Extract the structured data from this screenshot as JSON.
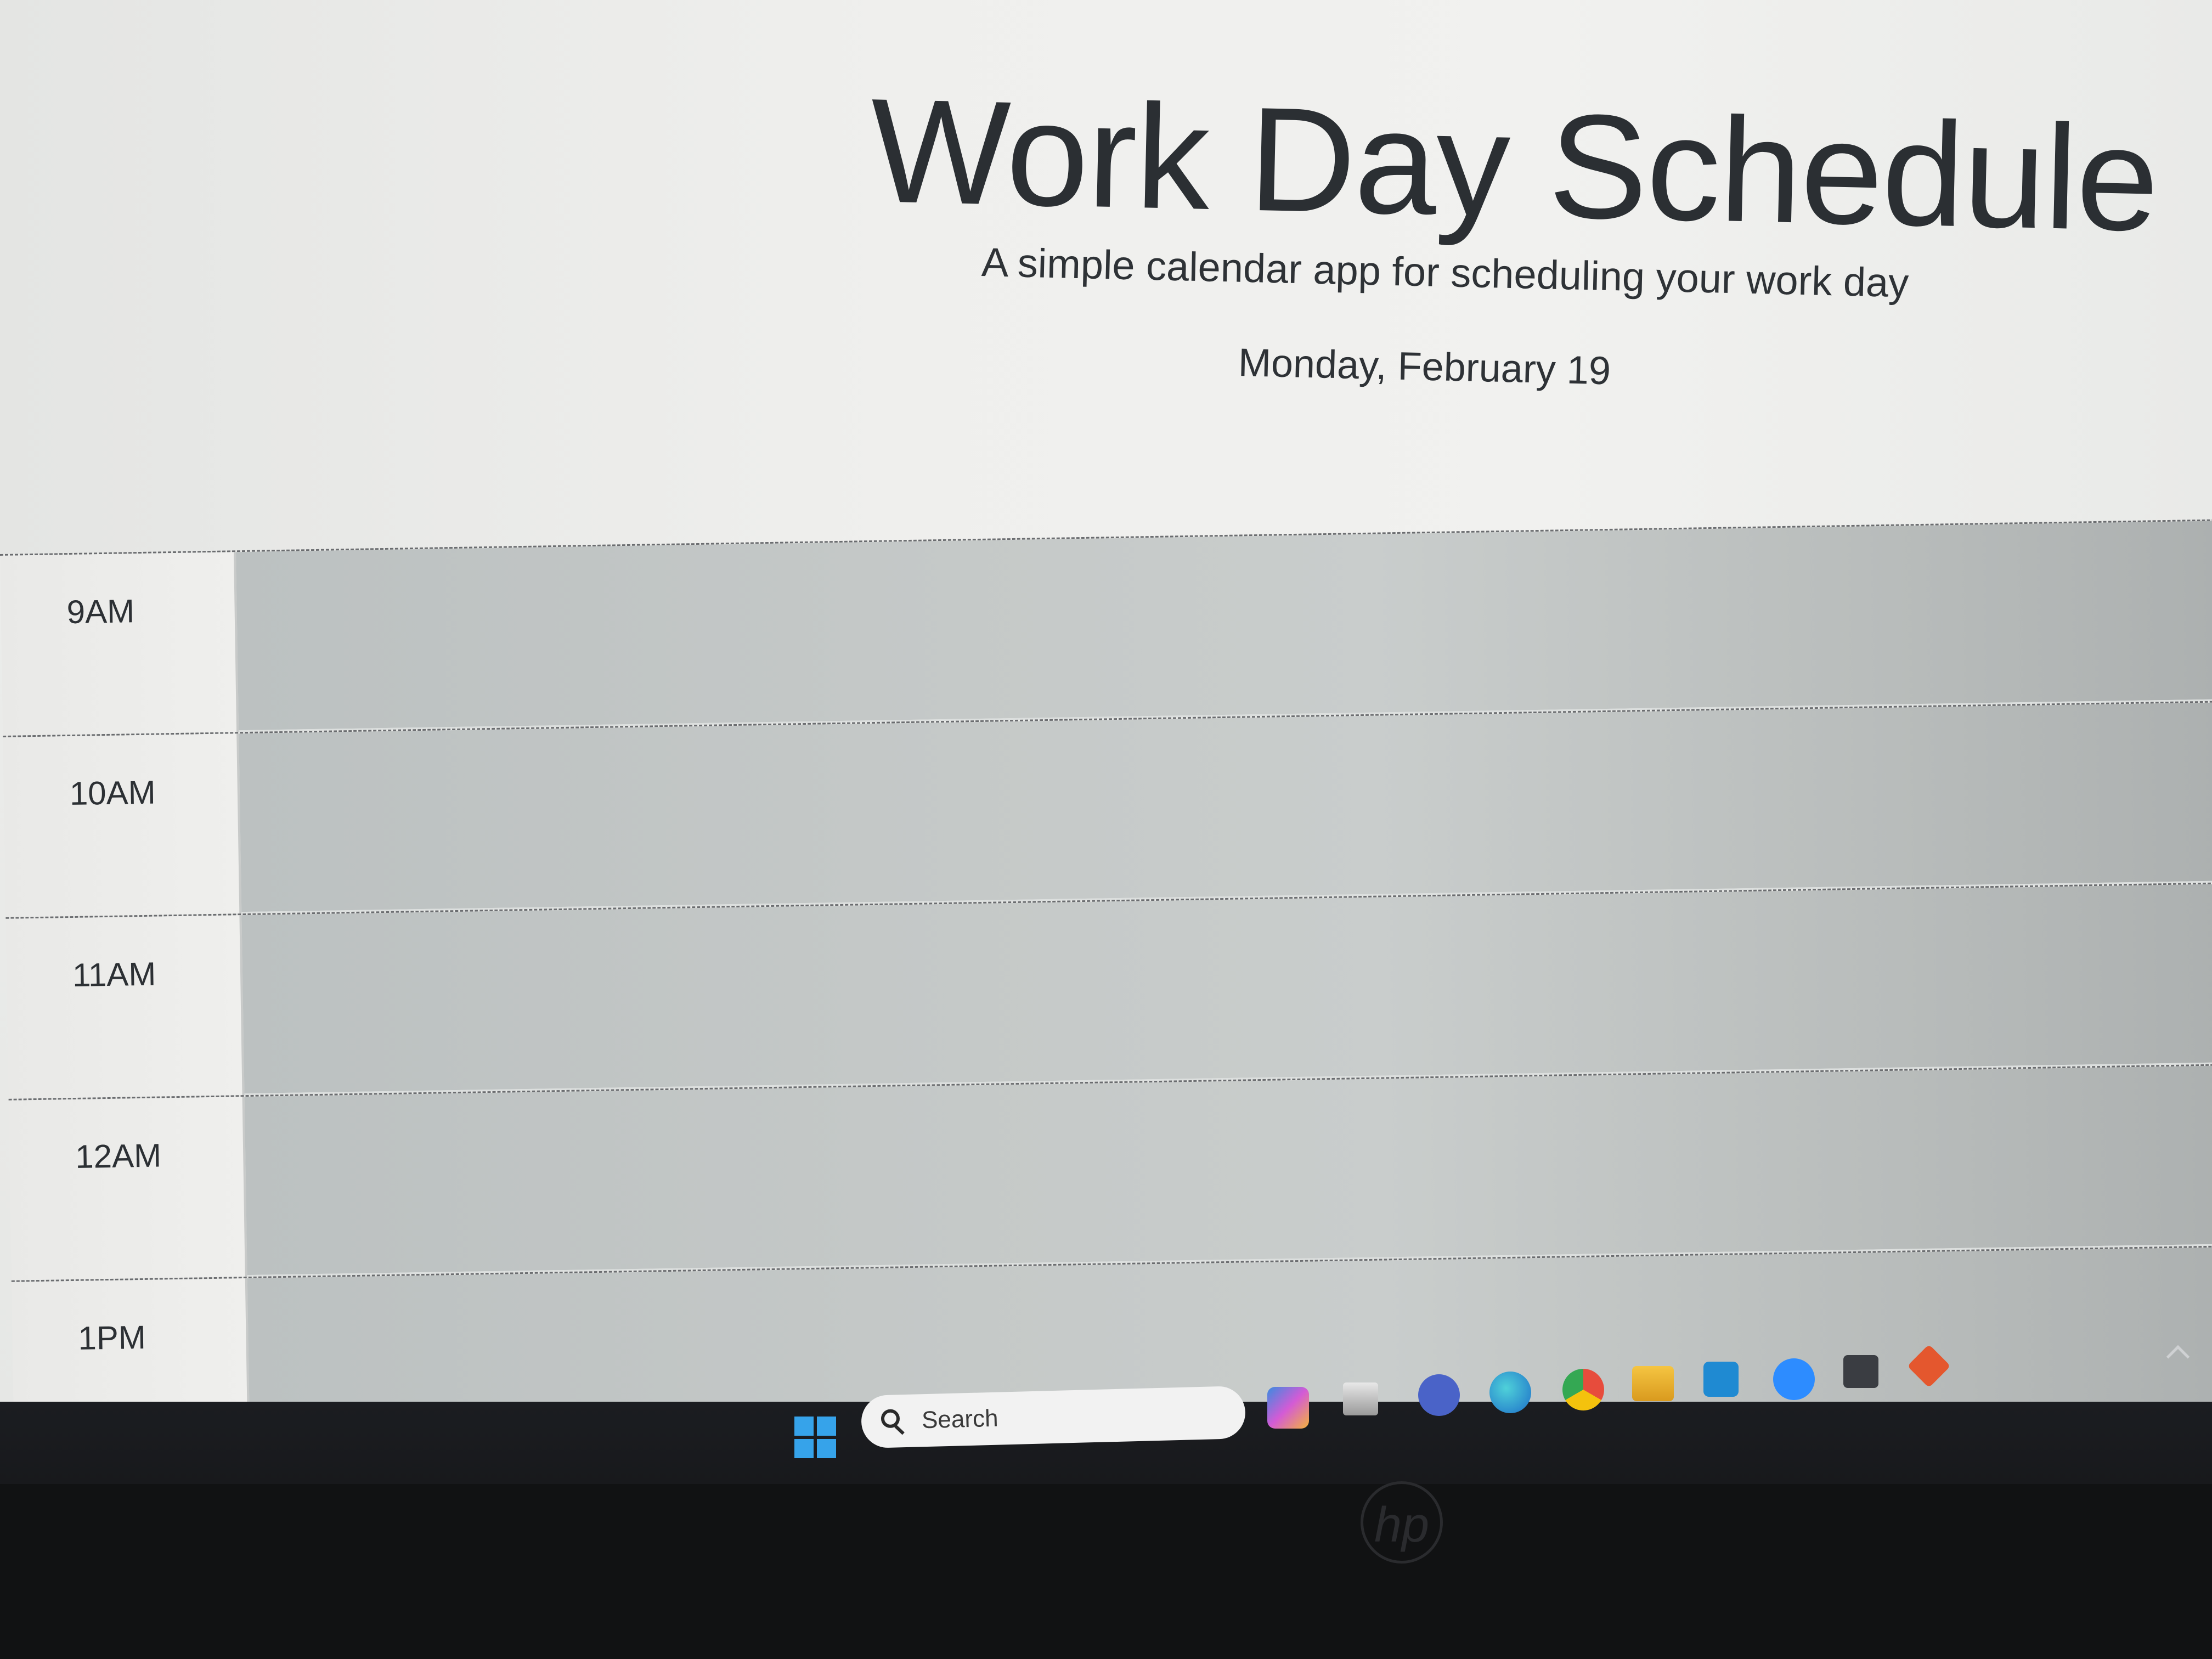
{
  "header": {
    "title": "Work Day Schedule",
    "subtitle": "A simple calendar app for scheduling your work day",
    "date": "Monday, February 19"
  },
  "schedule": {
    "hours": [
      "9AM",
      "10AM",
      "11AM",
      "12AM",
      "1PM"
    ]
  },
  "taskbar": {
    "search_placeholder": "Search",
    "apps": [
      "copilot-pre-icon",
      "task-view-icon",
      "teams-icon",
      "edge-icon",
      "chrome-icon",
      "file-explorer-icon",
      "vscode-icon",
      "zoom-icon",
      "terminal-icon",
      "git-icon"
    ]
  },
  "colors": {
    "header_bg": "#efefed",
    "row_bg": "#c5c9c8",
    "text": "#2b2f33",
    "taskbar_bg": "#1b1d21",
    "start_blue": "#36a3ea"
  }
}
